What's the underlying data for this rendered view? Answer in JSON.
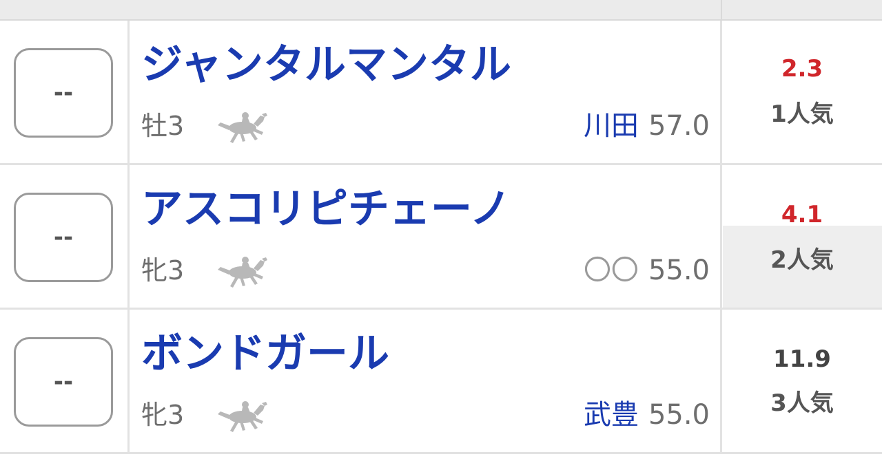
{
  "colors": {
    "horse_name": "#1a3bb0",
    "jockey": "#1a3bb0",
    "odds_popular": "#d0262b",
    "odds_normal": "#444444",
    "muted_text": "#6e6e6e"
  },
  "horses": [
    {
      "mark": "--",
      "name": "ジャンタルマンタル",
      "sex_age": "牡3",
      "jockey": "川田",
      "weight": "57.0",
      "odds": "2.3",
      "popularity": "1人気",
      "icon": "racehorse-icon"
    },
    {
      "mark": "--",
      "name": "アスコリピチェーノ",
      "sex_age": "牝3",
      "jockey": "〇〇",
      "weight": "55.0",
      "odds": "4.1",
      "popularity": "2人気",
      "icon": "racehorse-icon"
    },
    {
      "mark": "--",
      "name": "ボンドガール",
      "sex_age": "牝3",
      "jockey": "武豊",
      "weight": "55.0",
      "odds": "11.9",
      "popularity": "3人気",
      "icon": "racehorse-icon"
    }
  ]
}
